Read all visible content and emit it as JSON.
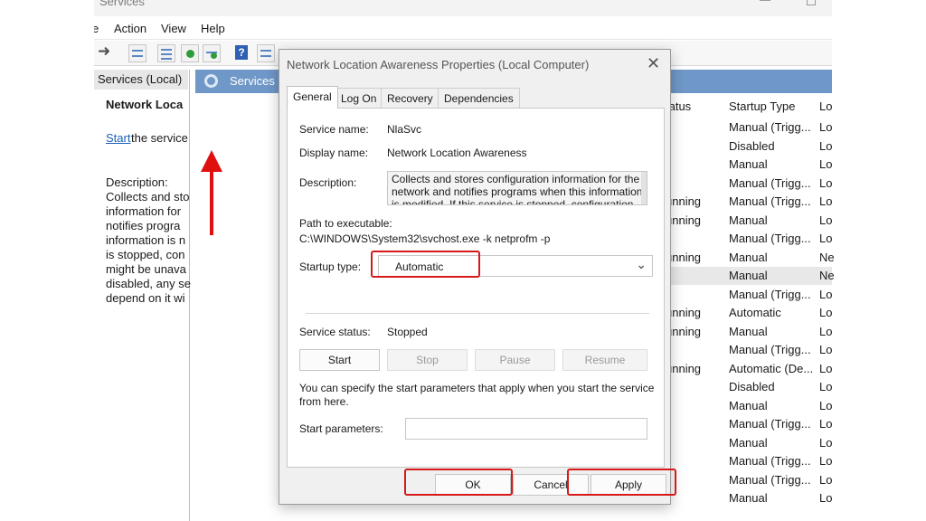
{
  "window": {
    "title": "Services"
  },
  "menu": [
    "e",
    "Action",
    "View",
    "Help"
  ],
  "left_pane": {
    "tree_item": "Services (Local)"
  },
  "main_header": {
    "title": "Services"
  },
  "detail": {
    "service_name": "Network Loca",
    "start_link": "Start",
    "start_rest": "the service",
    "description_label": "Description:",
    "description_lines": [
      "Collects and sto",
      "information for",
      "notifies progra",
      "information is n",
      "is stopped, con",
      "might be unava",
      "disabled, any se",
      "depend on it wi"
    ]
  },
  "services_list": {
    "header": {
      "status": "tatus",
      "startup": "Startup Type",
      "log": "Lo"
    },
    "rows": [
      {
        "status": "",
        "startup": "Manual (Trigg...",
        "log": "Lo"
      },
      {
        "status": "",
        "startup": "Disabled",
        "log": "Lo"
      },
      {
        "status": "",
        "startup": "Manual",
        "log": "Lo"
      },
      {
        "status": "",
        "startup": "Manual (Trigg...",
        "log": "Lo"
      },
      {
        "status": "unning",
        "startup": "Manual (Trigg...",
        "log": "Lo"
      },
      {
        "status": "unning",
        "startup": "Manual",
        "log": "Lo"
      },
      {
        "status": "",
        "startup": "Manual (Trigg...",
        "log": "Lo"
      },
      {
        "status": "unning",
        "startup": "Manual",
        "log": "Ne"
      },
      {
        "status": "",
        "startup": "Manual",
        "log": "Ne",
        "selected": true
      },
      {
        "status": "",
        "startup": "Manual (Trigg...",
        "log": "Lo"
      },
      {
        "status": "unning",
        "startup": "Automatic",
        "log": "Lo"
      },
      {
        "status": "unning",
        "startup": "Manual",
        "log": "Lo"
      },
      {
        "status": "",
        "startup": "Manual (Trigg...",
        "log": "Lo"
      },
      {
        "status": "unning",
        "startup": "Automatic (De...",
        "log": "Lo"
      },
      {
        "status": "",
        "startup": "Disabled",
        "log": "Lo"
      },
      {
        "status": "",
        "startup": "Manual",
        "log": "Lo"
      },
      {
        "status": "",
        "startup": "Manual (Trigg...",
        "log": "Lo"
      },
      {
        "status": "",
        "startup": "Manual",
        "log": "Lo"
      },
      {
        "status": "",
        "startup": "Manual (Trigg...",
        "log": "Lo"
      },
      {
        "status": "",
        "startup": "Manual (Trigg...",
        "log": "Lo"
      },
      {
        "status": "",
        "startup": "Manual",
        "log": "Lo"
      }
    ]
  },
  "dialog": {
    "title": "Network Location Awareness Properties (Local Computer)",
    "tabs": [
      "General",
      "Log On",
      "Recovery",
      "Dependencies"
    ],
    "service_name_label": "Service name:",
    "service_name_value": "NlaSvc",
    "display_name_label": "Display name:",
    "display_name_value": "Network Location Awareness",
    "description_label": "Description:",
    "description_lines": [
      "Collects and stores configuration information for the",
      "network and notifies programs when this information",
      "is modified. If this service is stopped, configuration"
    ],
    "path_label": "Path to executable:",
    "path_value": "C:\\WINDOWS\\System32\\svchost.exe -k netprofm -p",
    "startup_type_label": "Startup type:",
    "startup_type_value": "Automatic",
    "service_status_label": "Service status:",
    "service_status_value": "Stopped",
    "buttons": {
      "start": "Start",
      "stop": "Stop",
      "pause": "Pause",
      "resume": "Resume"
    },
    "params_help": [
      "You can specify the start parameters that apply when you start the service",
      "from here."
    ],
    "start_params_label": "Start parameters:",
    "footer": {
      "ok": "OK",
      "cancel": "Cancel",
      "apply": "Apply"
    }
  },
  "colors": {
    "accent_header": "#6f97c7",
    "annotation_red": "#d61a1a",
    "link_blue": "#1a5fb4"
  }
}
